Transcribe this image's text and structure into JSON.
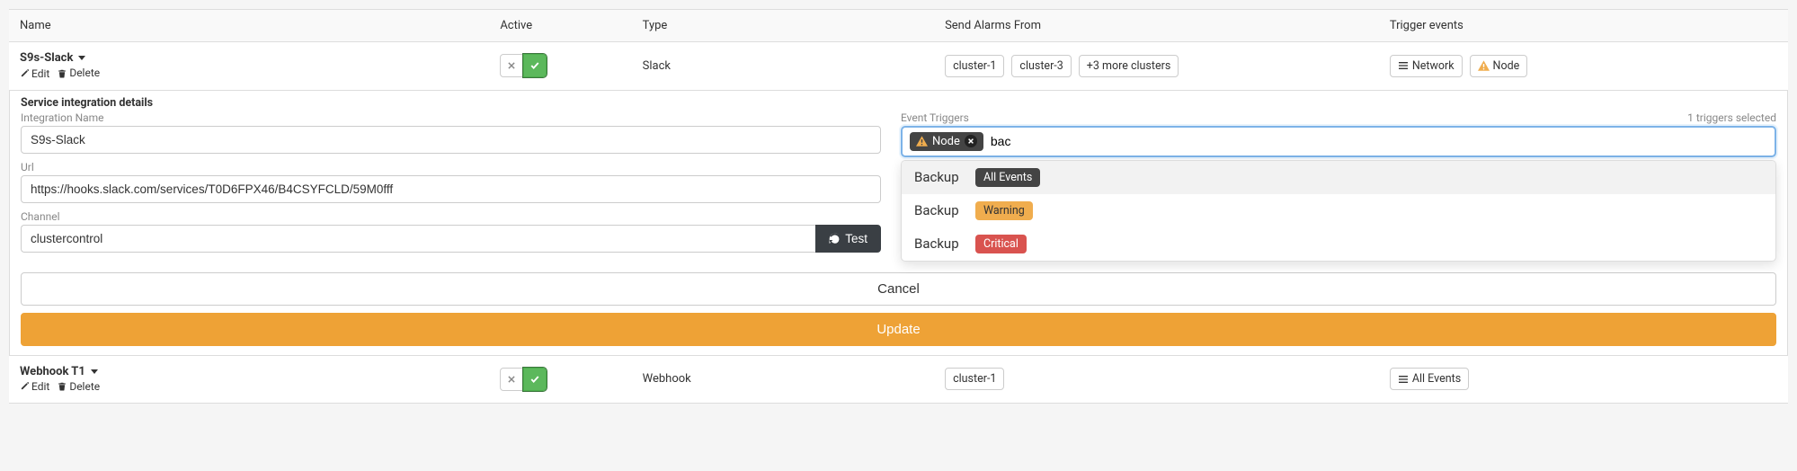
{
  "columns": {
    "name": "Name",
    "active": "Active",
    "type": "Type",
    "alarms_from": "Send Alarms From",
    "trigger_events": "Trigger events"
  },
  "rows": [
    {
      "name": "S9s-Slack",
      "actions": {
        "edit": "Edit",
        "delete": "Delete"
      },
      "type": "Slack",
      "alarms_from": [
        "cluster-1",
        "cluster-3",
        "+3 more clusters"
      ],
      "triggers": [
        {
          "icon": "menu",
          "label": "Network"
        },
        {
          "icon": "warn",
          "label": "Node"
        }
      ]
    },
    {
      "name": "Webhook T1",
      "actions": {
        "edit": "Edit",
        "delete": "Delete"
      },
      "type": "Webhook",
      "alarms_from": [
        "cluster-1"
      ],
      "triggers": [
        {
          "icon": "menu",
          "label": "All Events"
        }
      ]
    }
  ],
  "details": {
    "header": "Service integration details",
    "labels": {
      "integration_name": "Integration Name",
      "url": "Url",
      "channel": "Channel",
      "event_triggers": "Event Triggers"
    },
    "integration_name": "S9s-Slack",
    "url": "https://hooks.slack.com/services/T0D6FPX46/B4CSYFCLD/59M0fff",
    "channel": "clustercontrol",
    "test_button": "Test",
    "triggers_selected_count": "1 triggers selected",
    "selected_trigger": {
      "label": "Node"
    },
    "search_text": "bac",
    "dropdown": [
      {
        "name": "Backup",
        "badge": "All Events",
        "badge_class": "badge-dark"
      },
      {
        "name": "Backup",
        "badge": "Warning",
        "badge_class": "badge-warn"
      },
      {
        "name": "Backup",
        "badge": "Critical",
        "badge_class": "badge-crit"
      }
    ]
  },
  "buttons": {
    "cancel": "Cancel",
    "update": "Update"
  }
}
